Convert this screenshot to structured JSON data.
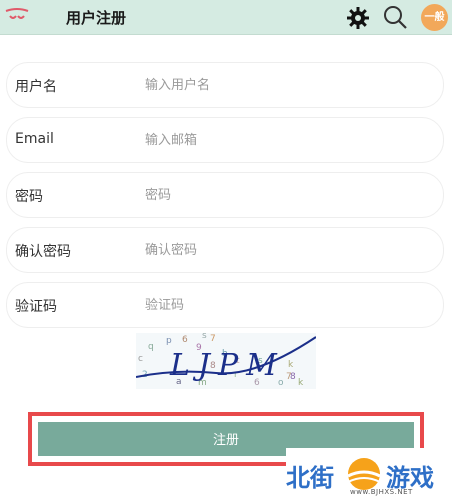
{
  "header": {
    "title": "用户注册",
    "avatar_label": "一般"
  },
  "form": {
    "fields": [
      {
        "label": "用户名",
        "placeholder": "输入用户名"
      },
      {
        "label": "Email",
        "placeholder": "输入邮箱"
      },
      {
        "label": "密码",
        "placeholder": "密码"
      },
      {
        "label": "确认密码",
        "placeholder": "确认密码"
      },
      {
        "label": "验证码",
        "placeholder": "验证码"
      }
    ],
    "submit_label": "注册"
  },
  "captcha": {
    "main_text": "LJPM",
    "noise_chars": [
      "p",
      "6",
      "s",
      "7",
      "q",
      "9",
      "c",
      "h",
      "2",
      "8",
      "a",
      "m",
      "t",
      "r",
      "s",
      "k",
      "6",
      "o",
      "k",
      "7",
      "8"
    ]
  },
  "watermark": {
    "left": "北街",
    "right": "游戏",
    "url": "www.BJHXS.NET"
  },
  "colors": {
    "header_bg": "#d5ebe2",
    "button_bg": "#78aa9b",
    "highlight_border": "#e8494b",
    "avatar_bg": "#f2a85a"
  },
  "icons": [
    "logo-icon",
    "gear-icon",
    "search-icon"
  ]
}
